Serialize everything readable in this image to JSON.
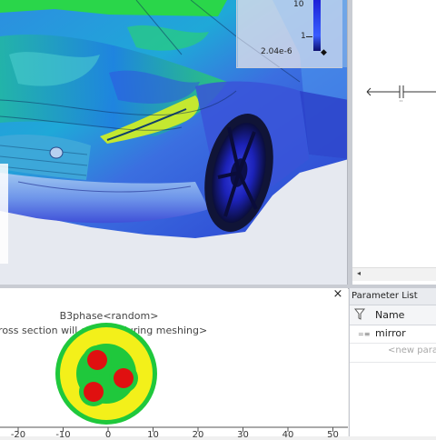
{
  "viewport": {
    "legend": {
      "top_value": "10",
      "mid_value": "1",
      "min_value": "2.04e-6"
    }
  },
  "schematic": {
    "scroll_left": "◂"
  },
  "cross_section": {
    "title": "B3phase<random>",
    "note": "cross section will change during meshing>",
    "close": "×",
    "x_ticks": [
      "-20",
      "-10",
      "0",
      "10",
      "20",
      "30",
      "40",
      "50"
    ]
  },
  "parameter_list": {
    "title": "Parameter List",
    "column_name": "Name",
    "rows": [
      {
        "icon": "parameter-icon",
        "name": "mirror"
      }
    ],
    "new_placeholder": "<new para"
  },
  "colors": {
    "field_high": "#2ad64a",
    "field_mid": "#1ab6d0",
    "field_low": "#1a2fd8",
    "conductor": "#e01010",
    "insulation": "#1fc83c",
    "sheath": "#f3f01a"
  }
}
